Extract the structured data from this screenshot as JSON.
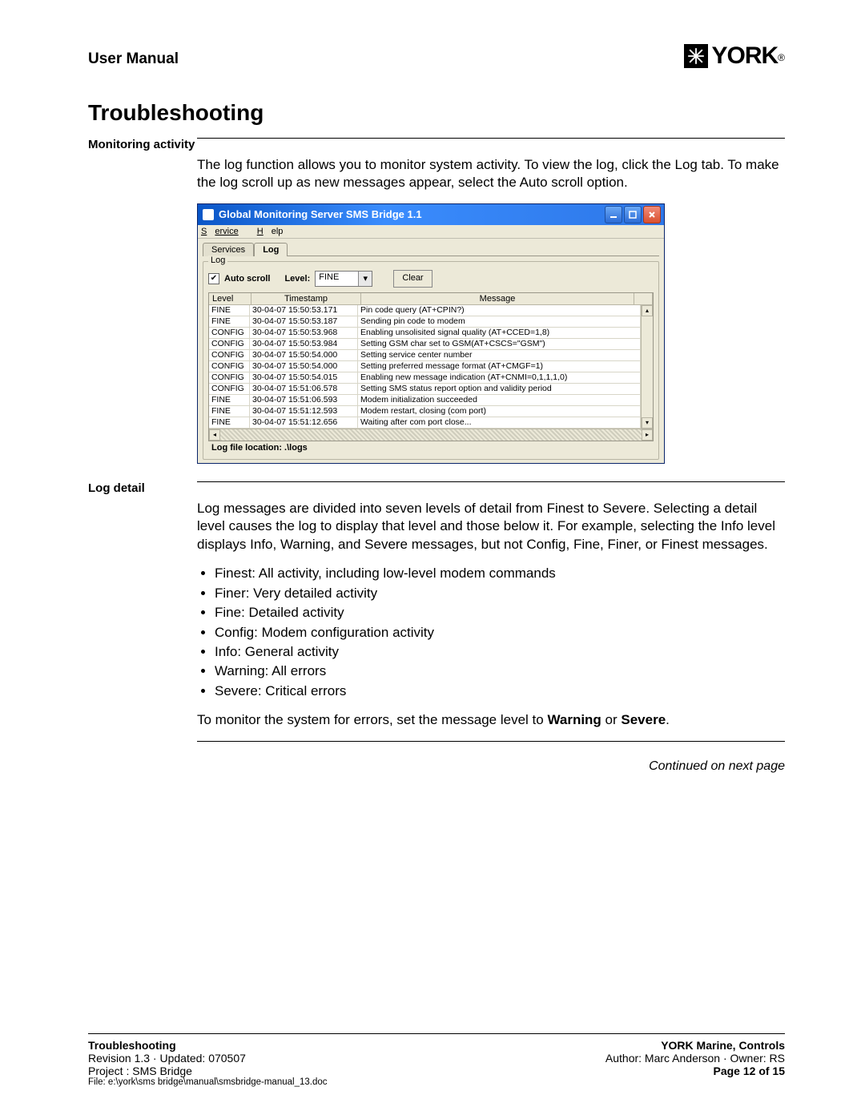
{
  "header": {
    "manual_label": "User Manual",
    "brand": "YORK"
  },
  "title": "Troubleshooting",
  "sections": {
    "monitoring": {
      "label": "Monitoring activity",
      "text": "The log function allows you to monitor system activity. To view the log, click the Log tab. To make the log scroll up as new messages appear, select the Auto scroll option."
    },
    "log_detail": {
      "label": "Log detail",
      "para1": "Log messages are divided into seven levels of detail from Finest to Severe. Selecting a detail level causes the log to display that level and those below it. For example, selecting the Info level displays Info, Warning, and Severe messages, but not Config, Fine, Finer, or Finest messages.",
      "bullets": [
        "Finest: All activity, including low-level modem commands",
        "Finer: Very detailed activity",
        "Fine: Detailed activity",
        "Config: Modem configuration activity",
        "Info: General activity",
        "Warning: All errors",
        "Severe: Critical errors"
      ],
      "para2_prefix": "To monitor the system for errors, set the message level to ",
      "para2_bold1": "Warning",
      "para2_mid": " or ",
      "para2_bold2": "Severe",
      "para2_suffix": "."
    }
  },
  "app": {
    "title": "Global Monitoring Server SMS Bridge 1.1",
    "menu": {
      "service": "Service",
      "help": "Help"
    },
    "tabs": {
      "services": "Services",
      "log": "Log"
    },
    "group_label": "Log",
    "autoscroll_label": "Auto scroll",
    "level_label": "Level:",
    "level_value": "FINE",
    "clear_label": "Clear",
    "columns": {
      "level": "Level",
      "timestamp": "Timestamp",
      "message": "Message"
    },
    "rows": [
      {
        "level": "FINE",
        "ts": "30-04-07 15:50:53.171",
        "msg": "Pin code query (AT+CPIN?)"
      },
      {
        "level": "FINE",
        "ts": "30-04-07 15:50:53.187",
        "msg": "Sending pin code to modem"
      },
      {
        "level": "CONFIG",
        "ts": "30-04-07 15:50:53.968",
        "msg": "Enabling unsolisited signal quality (AT+CCED=1,8)"
      },
      {
        "level": "CONFIG",
        "ts": "30-04-07 15:50:53.984",
        "msg": "Setting GSM char set to GSM(AT+CSCS=\"GSM\")"
      },
      {
        "level": "CONFIG",
        "ts": "30-04-07 15:50:54.000",
        "msg": "Setting service center number"
      },
      {
        "level": "CONFIG",
        "ts": "30-04-07 15:50:54.000",
        "msg": "Setting preferred message format (AT+CMGF=1)"
      },
      {
        "level": "CONFIG",
        "ts": "30-04-07 15:50:54.015",
        "msg": "Enabling new message indication (AT+CNMI=0,1,1,1,0)"
      },
      {
        "level": "CONFIG",
        "ts": "30-04-07 15:51:06.578",
        "msg": "Setting SMS status report option and validity period"
      },
      {
        "level": "FINE",
        "ts": "30-04-07 15:51:06.593",
        "msg": "Modem initialization succeeded"
      },
      {
        "level": "FINE",
        "ts": "30-04-07 15:51:12.593",
        "msg": "Modem restart, closing (com port)"
      },
      {
        "level": "FINE",
        "ts": "30-04-07 15:51:12.656",
        "msg": "Waiting after com port close..."
      }
    ],
    "log_location": "Log file location: .\\logs"
  },
  "continued": "Continued on next page",
  "footer": {
    "left_title": "Troubleshooting",
    "right_title": "YORK Marine, Controls",
    "revision": "Revision 1.3  ·  Updated: 070507",
    "author": "Author: Marc Anderson  ·  Owner: RS",
    "project": "Project : SMS Bridge",
    "page": "Page 12 of 15",
    "file": "File: e:\\york\\sms bridge\\manual\\smsbridge-manual_13.doc"
  }
}
